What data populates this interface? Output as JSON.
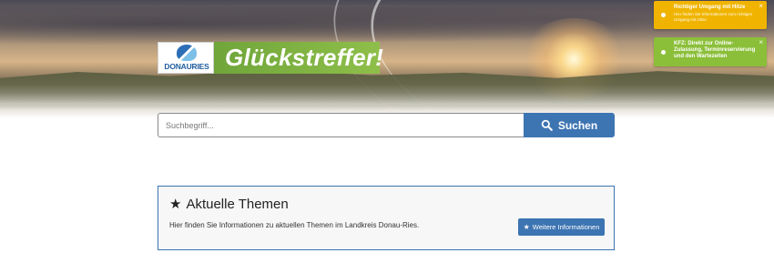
{
  "header": {
    "logo_text": "DONAURIES",
    "brand_title": "Glückstreffer!"
  },
  "notices": [
    {
      "title": "Richtiger Umgang mit Hitze",
      "subtitle": "Hier finden Sie Informationen zum richtigen Umgang mit Hitze",
      "close": "×",
      "color": "#f0b400"
    },
    {
      "title": "KFZ: Direkt zur Online-Zulassung, Terminreservierung und den Wartezeiten",
      "subtitle": "",
      "close": "×",
      "color": "#8bbf3a"
    }
  ],
  "search": {
    "placeholder": "Suchbegriff...",
    "value": "",
    "button_label": "Suchen"
  },
  "topics": {
    "title": "Aktuelle Themen",
    "description": "Hier finden Sie Informationen zu aktuellen Themen im Landkreis Donau-Ries.",
    "button_label": "Weitere Informationen",
    "star_icon": "★"
  },
  "colors": {
    "primary_blue": "#3d74b2",
    "brand_green": "#8fbf4a",
    "notice_yellow": "#f0b400",
    "notice_green": "#8bbf3a"
  }
}
